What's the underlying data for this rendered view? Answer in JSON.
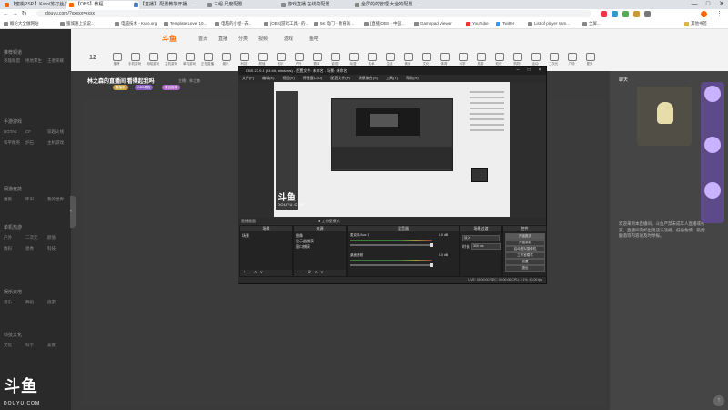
{
  "browser": {
    "tabs": [
      {
        "label": "【蜜桃PSP 】Kuro/苏打丝多 ...",
        "active": false
      },
      {
        "label": "【OBS】教程...",
        "active": true
      },
      {
        "label": "【直播】 配置教学开播 ...",
        "active": false
      },
      {
        "label": "三组 尺度配置",
        "active": false
      },
      {
        "label": "游戏直播 在线的配置 ...",
        "active": false
      },
      {
        "label": "全屏的的管理 大全的配置 ...",
        "active": false
      }
    ],
    "window_buttons": [
      "—",
      "□",
      "✕"
    ],
    "url": "douyu.com/?xxxxx=xxxx",
    "bookmarks": [
      "概论大全做网站",
      "蜜城路上说说...",
      "电脑技术 - Kuro.org",
      "Template Level 10...",
      "电脑的小屋- 去...",
      "[OBS]游戏工具 - 的...",
      "5K 电门 - 教育的...",
      "[直播]OBS - 中国...",
      "Gamepad Viewer",
      "YouTube",
      "Twitter",
      "List of player sam...",
      "全屏..."
    ],
    "bookmark_extra": "其他书签"
  },
  "sidebar": {
    "groups": [
      "推荐频道",
      "手游游戏",
      "网游竞技",
      "单机热游",
      "娱乐天地",
      "科技文化"
    ],
    "items": [
      [
        "英雄联盟",
        "绝地求生",
        "王者荣耀"
      ],
      [
        "DOTA2",
        "CF",
        "穿越火线"
      ],
      [
        "和平精英",
        "炉石",
        "主机游戏"
      ],
      [
        "魔兽",
        "怀旧",
        "我的世界"
      ],
      [
        "户外",
        "二次元",
        "颜值"
      ],
      [
        "数码",
        "星秀",
        "科技"
      ],
      [
        "音乐",
        "舞蹈",
        "旅游"
      ],
      [
        "文化",
        "科学",
        "美食"
      ]
    ]
  },
  "header": {
    "logo": "斗鱼",
    "nav": [
      "首页",
      "直播",
      "分类",
      "视频",
      "游戏",
      "鱼吧"
    ],
    "date": "12",
    "categories": [
      "推荐",
      "手机游戏",
      "网络游戏",
      "主机游戏",
      "单机游戏",
      "正在直播",
      "娱乐",
      "科技",
      "颜值",
      "音乐",
      "户外",
      "赛事",
      "影视",
      "动漫",
      "技术",
      "生活",
      "美食",
      "文化",
      "体育",
      "科学",
      "旅游",
      "知识",
      "购物",
      "活动",
      "二次元",
      "广场",
      "更多"
    ]
  },
  "stream": {
    "title": "林之森的直播间 看得起我吗",
    "host": "主播：林之森",
    "badges": [
      "直播中",
      "OBS教程",
      "原创推荐"
    ],
    "badge_colors": [
      "#c9a64a",
      "#8a5fc4",
      "#b06ac9"
    ]
  },
  "right_panel": {
    "header": "聊天",
    "text": "欢迎来到本直播间，斗鱼严禁未成年人直播或打赏。直播间内如出现违法违规、低俗色情、吸烟酗酒等内容请及时举报。"
  },
  "obs": {
    "title": "OBS 27.0.1 (64 bit, windows) - 配置文件: 未命名 - 场景: 未命名",
    "menu": [
      "文件(F)",
      "编辑(E)",
      "视图(V)",
      "停靠窗口(D)",
      "配置文件(P)",
      "场景集合(S)",
      "工具(T)",
      "帮助(H)"
    ],
    "preview_logo": "斗鱼",
    "preview_domain": "DOUYU.COM",
    "stats": "直播画面",
    "studio_toggle": "● 工作室模式",
    "docks": {
      "scenes": {
        "header": "场景",
        "items": [
          "场景"
        ]
      },
      "sources": {
        "header": "来源",
        "items": [
          "图像",
          "显示器捕获",
          "窗口捕获"
        ]
      },
      "mixer": {
        "header": "混音器",
        "channels": [
          {
            "name": "麦克风/Aux 1",
            "db": "0.0 dB"
          },
          {
            "name": "桌面音频",
            "db": "0.0 dB"
          }
        ]
      },
      "transitions": {
        "header": "场景过渡",
        "type_label": "淡入",
        "duration_label": "时长",
        "duration": "300 ms"
      },
      "controls": {
        "header": "控件",
        "buttons": [
          "开始推流",
          "开始录制",
          "启动虚拟摄像机",
          "工作室模式",
          "设置",
          "退出"
        ]
      }
    },
    "status": "LIVE: 00:00:00   REC: 00:00:00   CPU: 2.1%, 60.00 fps"
  },
  "watermark": {
    "logo": "斗鱼",
    "domain": "DOUYU.COM"
  }
}
